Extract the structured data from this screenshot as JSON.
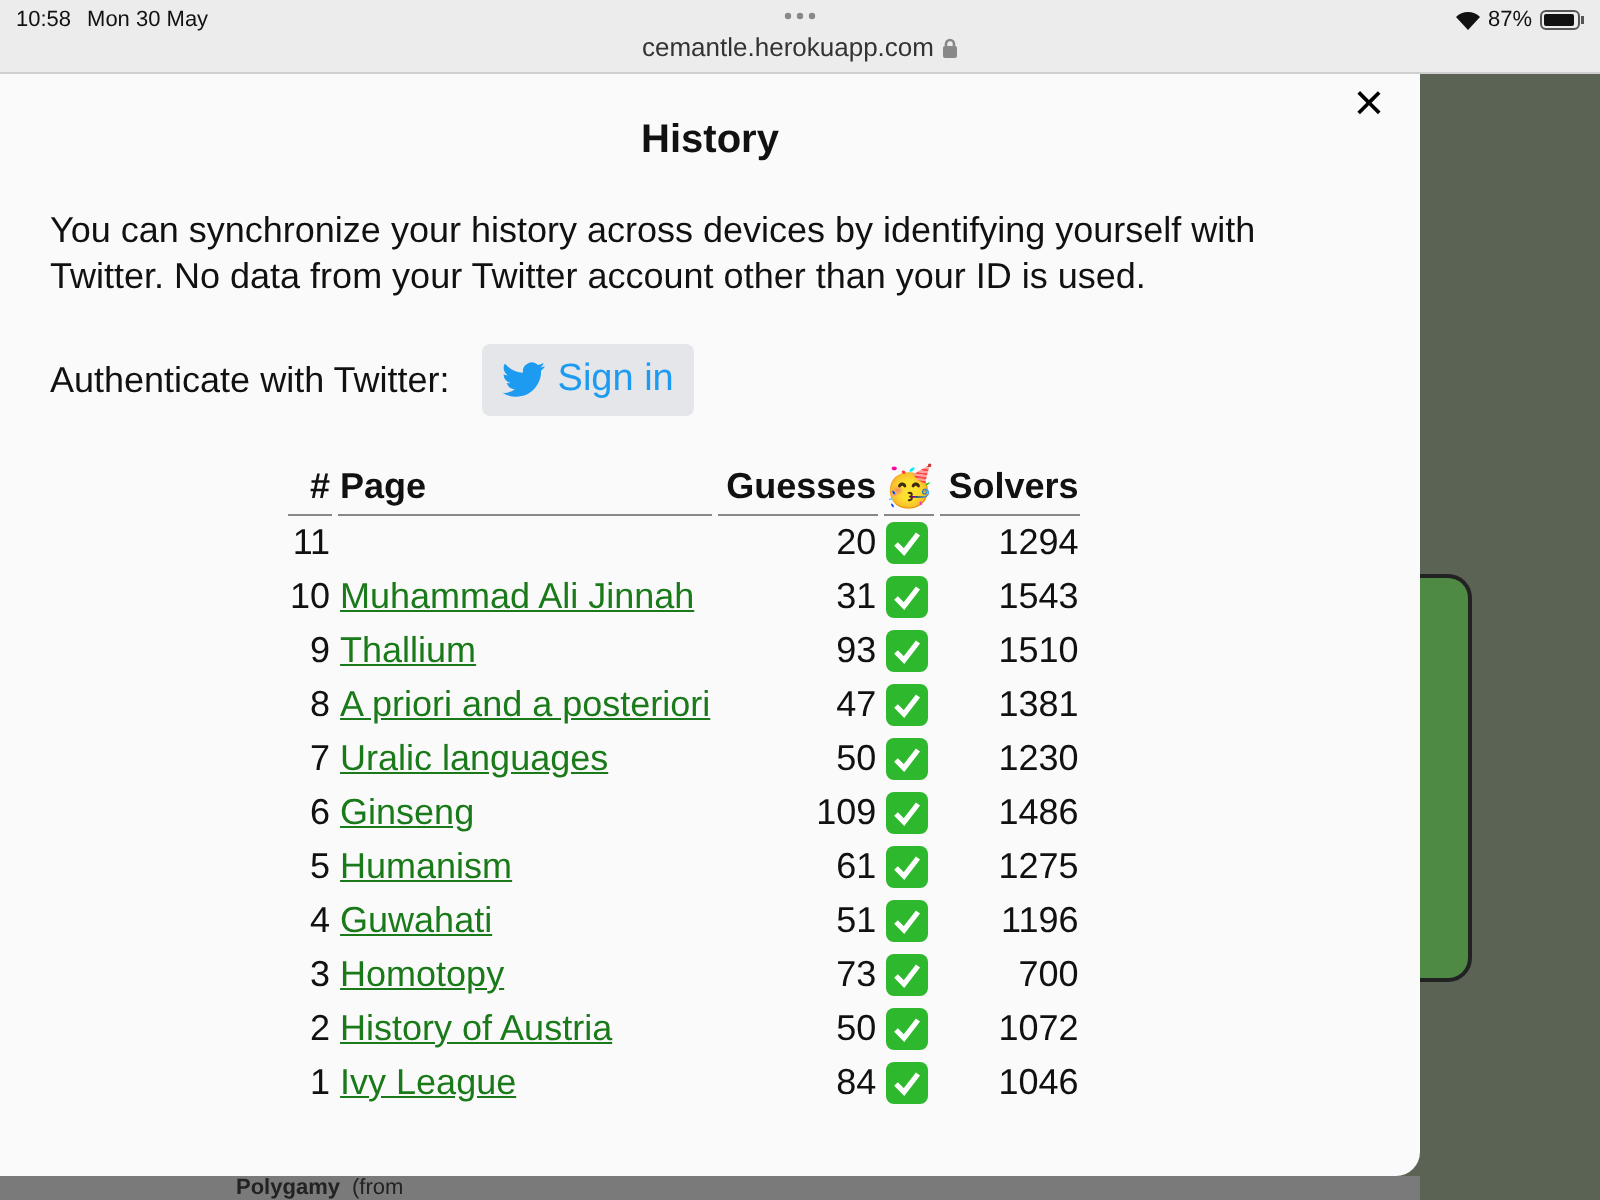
{
  "status_bar": {
    "time": "10:58",
    "date": "Mon 30 May",
    "url": "cemantle.herokuapp.com",
    "battery": "87%"
  },
  "modal": {
    "title": "History",
    "close": "×",
    "description": "You can synchronize your history across devices by identifying yourself with Twitter. No data from your Twitter account other than your ID is used.",
    "auth_label": "Authenticate with Twitter:",
    "sign_in": "Sign in"
  },
  "table": {
    "columns": [
      "#",
      "Page",
      "Guesses",
      "🥳",
      "Solvers"
    ],
    "rows": [
      {
        "number": "11",
        "page": "",
        "guesses": "20",
        "solved": true,
        "solvers": "1294"
      },
      {
        "number": "10",
        "page": "Muhammad Ali Jinnah",
        "guesses": "31",
        "solved": true,
        "solvers": "1543"
      },
      {
        "number": "9",
        "page": "Thallium",
        "guesses": "93",
        "solved": true,
        "solvers": "1510"
      },
      {
        "number": "8",
        "page": "A priori and a posteriori",
        "guesses": "47",
        "solved": true,
        "solvers": "1381"
      },
      {
        "number": "7",
        "page": "Uralic languages",
        "guesses": "50",
        "solved": true,
        "solvers": "1230"
      },
      {
        "number": "6",
        "page": "Ginseng",
        "guesses": "109",
        "solved": true,
        "solvers": "1486"
      },
      {
        "number": "5",
        "page": "Humanism",
        "guesses": "61",
        "solved": true,
        "solvers": "1275"
      },
      {
        "number": "4",
        "page": "Guwahati",
        "guesses": "51",
        "solved": true,
        "solvers": "1196"
      },
      {
        "number": "3",
        "page": "Homotopy",
        "guesses": "73",
        "solved": true,
        "solvers": "700"
      },
      {
        "number": "2",
        "page": "History of Austria",
        "guesses": "50",
        "solved": true,
        "solvers": "1072"
      },
      {
        "number": "1",
        "page": "Ivy League",
        "guesses": "84",
        "solved": true,
        "solvers": "1046"
      }
    ]
  },
  "background": {
    "word": "Polygamy",
    "note": "(from"
  }
}
